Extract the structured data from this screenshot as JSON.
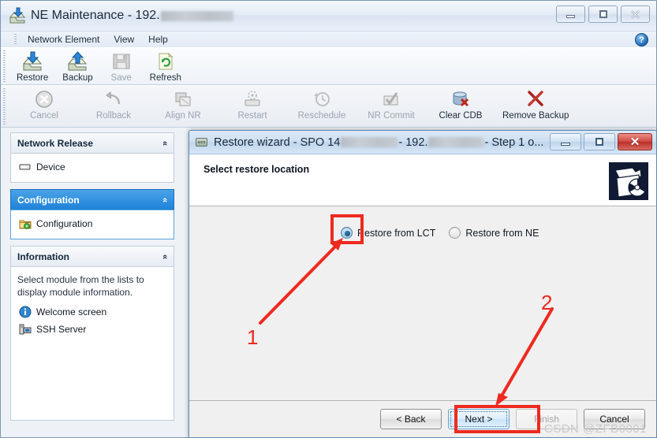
{
  "window": {
    "title_prefix": "NE Maintenance - 192.",
    "icon": "restore-icon",
    "controls": {
      "minimize": "Minimize",
      "maximize": "Maximize",
      "close": "Close"
    }
  },
  "menu": {
    "items": [
      {
        "label": "Network Element"
      },
      {
        "label": "View"
      },
      {
        "label": "Help"
      }
    ],
    "help_icon_glyph": "?"
  },
  "toolbar_primary": [
    {
      "label": "Restore",
      "icon": "restore-icon",
      "enabled": true
    },
    {
      "label": "Backup",
      "icon": "backup-icon",
      "enabled": true
    },
    {
      "label": "Save",
      "icon": "save-icon",
      "enabled": false
    },
    {
      "label": "Refresh",
      "icon": "refresh-icon",
      "enabled": true
    }
  ],
  "toolbar_secondary": [
    {
      "label": "Cancel",
      "icon": "cancel-icon",
      "enabled": false
    },
    {
      "label": "Rollback",
      "icon": "rollback-icon",
      "enabled": false
    },
    {
      "label": "Align NR",
      "icon": "align-nr-icon",
      "enabled": false
    },
    {
      "label": "Restart",
      "icon": "restart-icon",
      "enabled": false
    },
    {
      "label": "Reschedule",
      "icon": "reschedule-icon",
      "enabled": false
    },
    {
      "label": "NR Commit",
      "icon": "nr-commit-icon",
      "enabled": false
    },
    {
      "label": "Clear CDB",
      "icon": "clear-cdb-icon",
      "enabled": true
    },
    {
      "label": "Remove Backup",
      "icon": "remove-backup-icon",
      "enabled": true
    }
  ],
  "sidebar": {
    "panels": [
      {
        "title": "Network Release",
        "active": false,
        "collapse_glyph": "«",
        "items": [
          {
            "label": "Device",
            "icon": "device-icon"
          }
        ]
      },
      {
        "title": "Configuration",
        "active": true,
        "collapse_glyph": "«",
        "items": [
          {
            "label": "Configuration",
            "icon": "configuration-folder-icon"
          }
        ]
      },
      {
        "title": "Information",
        "active": false,
        "collapse_glyph": "«",
        "description": "Select module from the lists to display module information.",
        "items": [
          {
            "label": "Welcome screen",
            "icon": "info-icon"
          },
          {
            "label": "SSH Server",
            "icon": "server-icon"
          }
        ]
      }
    ]
  },
  "dialog": {
    "title_part1": "Restore wizard - SPO 14",
    "title_part2": " - 192.",
    "title_part3": " - Step 1 o...",
    "icon": "window-icon",
    "controls": {
      "minimize": "Minimize",
      "maximize": "Maximize",
      "close": "✕"
    },
    "header_title": "Select restore location",
    "banner_icon": "wizard-banner-icon",
    "radio_options": [
      {
        "label": "Restore from LCT",
        "selected": true
      },
      {
        "label": "Restore from NE",
        "selected": false
      }
    ],
    "buttons": [
      {
        "label": "< Back",
        "state": "normal"
      },
      {
        "label": "Next >",
        "state": "focused"
      },
      {
        "label": "Finish",
        "state": "disabled"
      },
      {
        "label": "Cancel",
        "state": "normal"
      }
    ],
    "watermark": "CSDN @ZFB0001"
  },
  "annotations": {
    "color": "#ee2a1f",
    "markers": [
      {
        "label": "1",
        "target": "radio-restore-from-lct"
      },
      {
        "label": "2",
        "target": "next-button"
      }
    ]
  }
}
